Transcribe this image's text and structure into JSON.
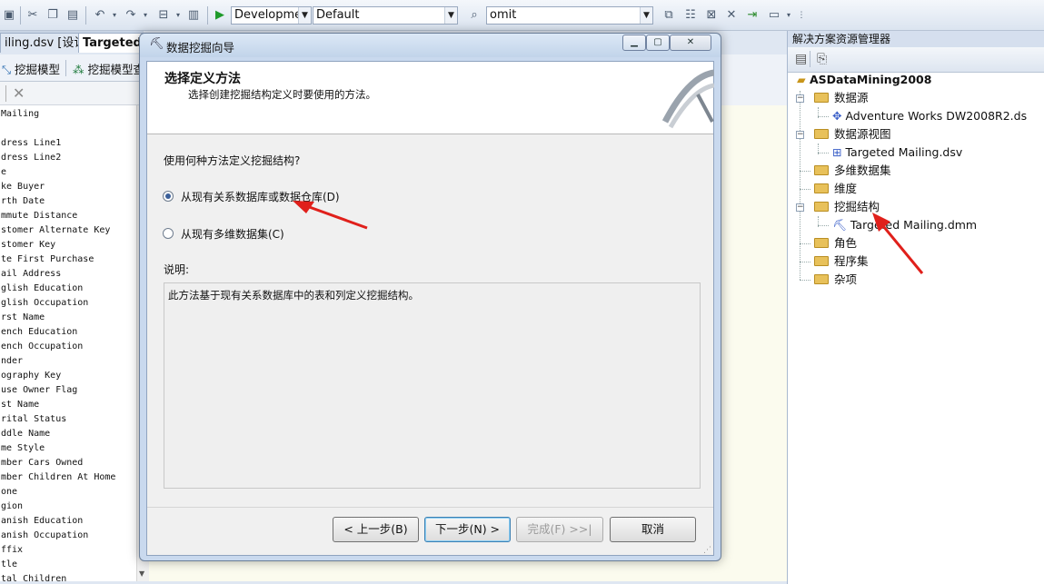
{
  "toolbar": {
    "config_combo": "Developmer",
    "platform_combo": "Default",
    "find_combo": "omit"
  },
  "doc_tabs": {
    "tab1": "iling.dsv [设计]",
    "tab2": "Targeted"
  },
  "designer_tabs": {
    "mining_model": "挖掘模型",
    "mining_model_viewer": "挖掘模型查"
  },
  "left_columns": {
    "header": "Mailing",
    "items": [
      "dress Line1",
      "dress Line2",
      "e",
      "ke Buyer",
      "rth Date",
      "mmute Distance",
      "stomer Alternate Key",
      "stomer Key",
      "te First Purchase",
      "ail Address",
      "glish Education",
      "glish Occupation",
      "rst Name",
      "ench Education",
      "ench Occupation",
      "nder",
      "ography Key",
      "use Owner Flag",
      "st Name",
      "rital Status",
      "ddle Name",
      "me Style",
      "mber Cars Owned",
      "mber Children At Home",
      "one",
      "gion",
      "anish Education",
      "anish Occupation",
      "ffix",
      "tle",
      "tal Children"
    ]
  },
  "solution_explorer": {
    "title": "解决方案资源管理器",
    "project": "ASDataMining2008",
    "nodes": {
      "data_sources": "数据源",
      "data_source_item": "Adventure Works DW2008R2.ds",
      "dsv": "数据源视图",
      "dsv_item": "Targeted Mailing.dsv",
      "cubes": "多维数据集",
      "dimensions": "维度",
      "mining_structures": "挖掘结构",
      "mining_item": "Targeted Mailing.dmm",
      "roles": "角色",
      "assemblies": "程序集",
      "misc": "杂项"
    }
  },
  "dialog": {
    "title": "数据挖掘向导",
    "heading": "选择定义方法",
    "subheading": "选择创建挖掘结构定义时要使用的方法。",
    "question": "使用何种方法定义挖掘结构?",
    "option1": "从现有关系数据库或数据仓库(D)",
    "option2": "从现有多维数据集(C)",
    "desc_label": "说明:",
    "description": "此方法基于现有关系数据库中的表和列定义挖掘结构。",
    "buttons": {
      "back": "< 上一步(B)",
      "next": "下一步(N) >",
      "finish": "完成(F) >>|",
      "cancel": "取消"
    }
  },
  "colors": {
    "arrow_red": "#e0201b",
    "radio_selected": "#3b5f99",
    "folder_yellow": "#e8c15a"
  }
}
